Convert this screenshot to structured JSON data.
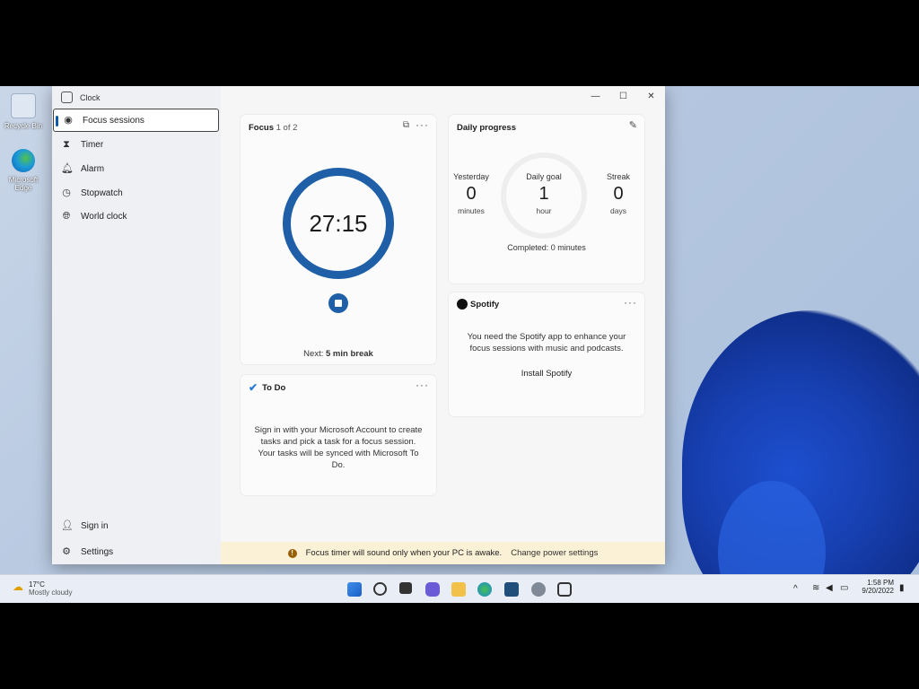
{
  "desktop": {
    "recycle_bin_label": "Recycle Bin",
    "edge_label": "Microsoft Edge"
  },
  "window": {
    "app_title": "Clock",
    "nav": [
      {
        "label": "Focus sessions",
        "icon": "focus-icon"
      },
      {
        "label": "Timer",
        "icon": "hourglass-icon"
      },
      {
        "label": "Alarm",
        "icon": "bell-icon"
      },
      {
        "label": "Stopwatch",
        "icon": "stopwatch-icon"
      },
      {
        "label": "World clock",
        "icon": "globe-icon"
      }
    ],
    "nav_bottom": [
      {
        "label": "Sign in",
        "icon": "person-icon"
      },
      {
        "label": "Settings",
        "icon": "gear-icon"
      }
    ]
  },
  "focus": {
    "title": "Focus",
    "counter": "1 of 2",
    "time": "27:15",
    "next_label": "Next:",
    "next_value": "5 min break",
    "ring_color": "#1f5fa8"
  },
  "daily": {
    "title": "Daily progress",
    "yesterday_label": "Yesterday",
    "yesterday_value": "0",
    "yesterday_unit": "minutes",
    "goal_label": "Daily goal",
    "goal_value": "1",
    "goal_unit": "hour",
    "streak_label": "Streak",
    "streak_value": "0",
    "streak_unit": "days",
    "completed": "Completed: 0 minutes"
  },
  "spotify": {
    "title": "Spotify",
    "message": "You need the Spotify app to enhance your focus sessions with music and podcasts.",
    "install_label": "Install Spotify"
  },
  "todo": {
    "title": "To Do",
    "message": "Sign in with your Microsoft Account to create tasks and pick a task for a focus session. Your tasks will be synced with Microsoft To Do."
  },
  "banner": {
    "message": "Focus timer will sound only when your PC is awake.",
    "link": "Change power settings"
  },
  "taskbar": {
    "weather_temp": "17°C",
    "weather_desc": "Mostly cloudy",
    "time": "1:58 PM",
    "date": "9/20/2022"
  },
  "colors": {
    "accent": "#1f5fa8",
    "banner_bg": "#fbf1d6"
  }
}
